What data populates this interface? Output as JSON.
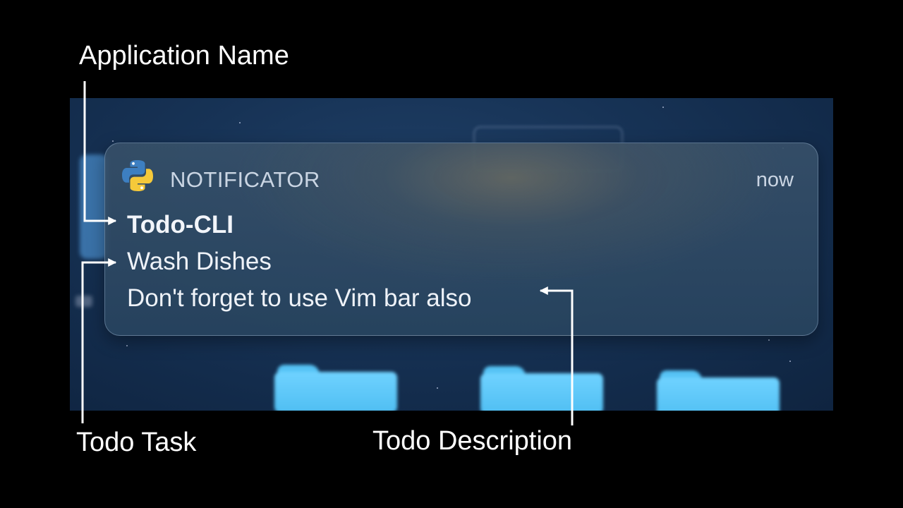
{
  "notification": {
    "app_name": "NOTIFICATOR",
    "time": "now",
    "title": "Todo-CLI",
    "subtitle": "Wash Dishes",
    "message": "Don't forget to use Vim bar also",
    "app_icon": "python-logo-icon"
  },
  "annotations": {
    "application_name": "Application Name",
    "todo_task": "Todo Task",
    "todo_description": "Todo Description"
  },
  "colors": {
    "page_background": "#000000",
    "desktop_background": "#173356",
    "folder_blue": "#5ac8fa",
    "python_blue": "#3d7fc1",
    "python_yellow": "#f5c93a"
  }
}
